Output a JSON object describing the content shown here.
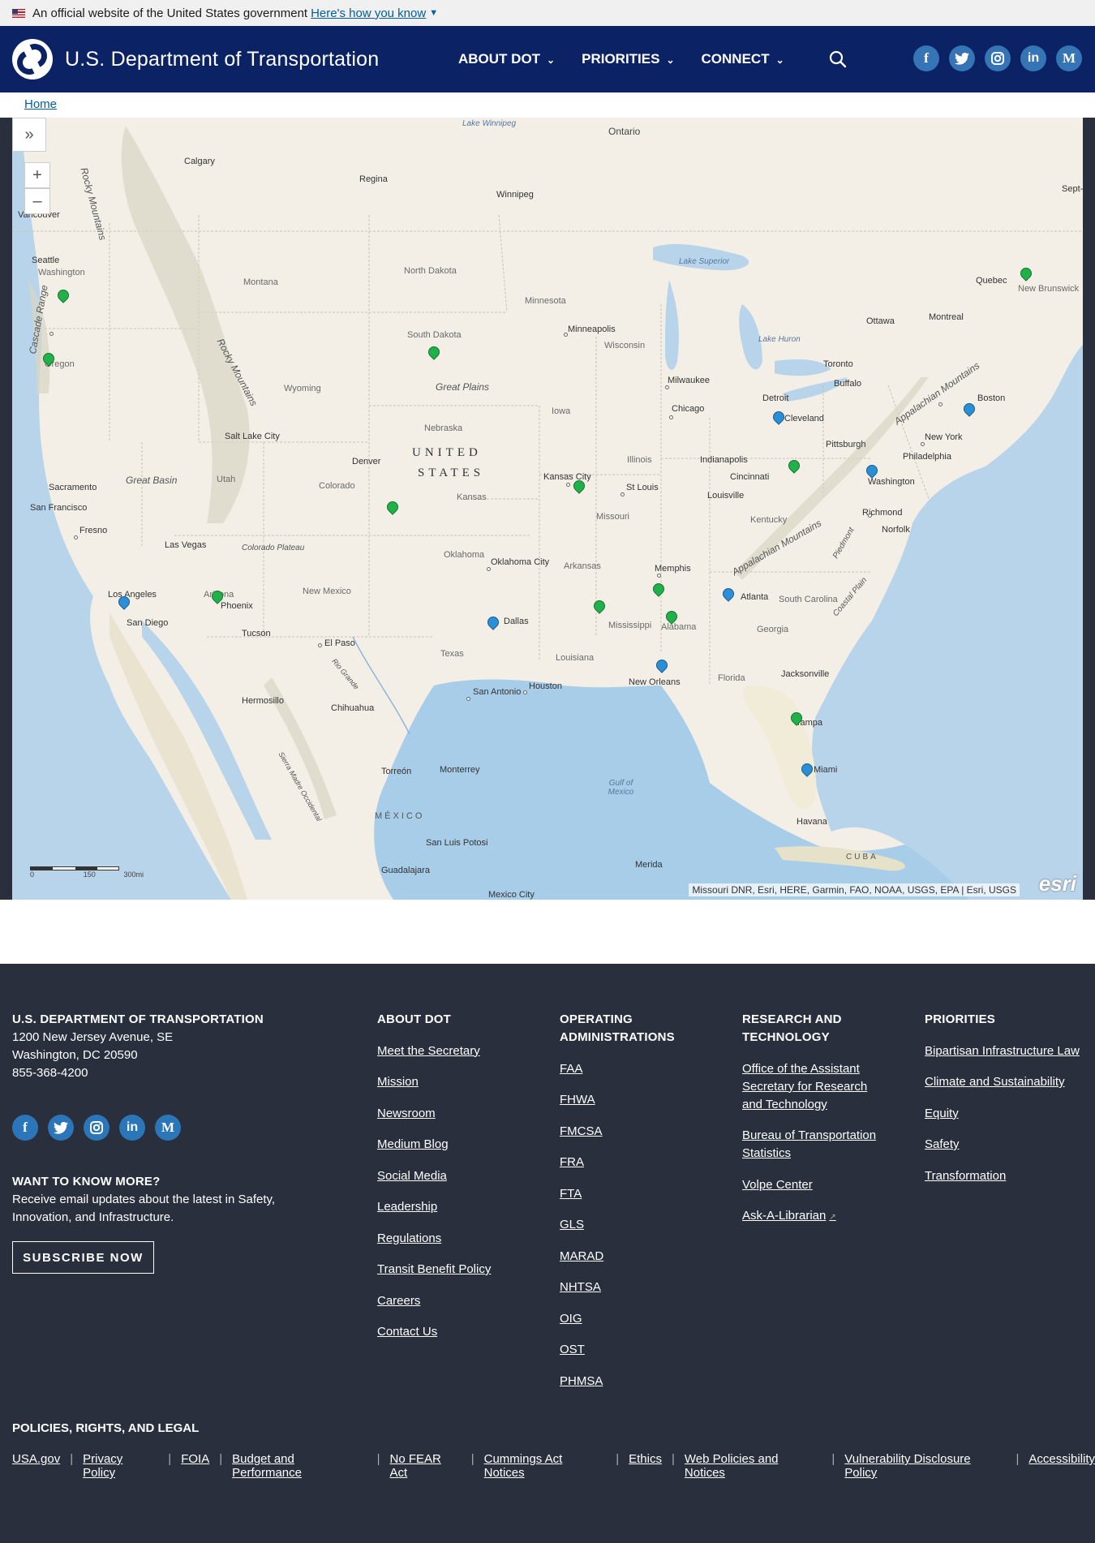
{
  "gov_banner": {
    "text": "An official website of the United States government",
    "link": "Here's how you know"
  },
  "header": {
    "title": "U.S. Department of Transportation",
    "nav": [
      "ABOUT DOT",
      "PRIORITIES",
      "CONNECT"
    ],
    "social": [
      "f",
      "t",
      "ig",
      "in",
      "M"
    ]
  },
  "breadcrumb": {
    "home": "Home"
  },
  "map": {
    "attribution": "Missouri DNR, Esri, HERE, Garmin, FAO, NOAA, USGS, EPA | Esri, USGS",
    "logo": "esri",
    "scale": [
      "0",
      "150",
      "300mi"
    ],
    "labels": {
      "winnipeg_lake": "Lake Winnipeg",
      "ontario": "Ontario",
      "rocky_mountains_n": "Rocky Mountains",
      "calgary": "Calgary",
      "regina": "Regina",
      "winnipeg": "Winnipeg",
      "vancouver": "Vancouver",
      "seattle": "Seattle",
      "washington_state": "Washington",
      "montana": "Montana",
      "north_dakota": "North Dakota",
      "minnesota": "Minnesota",
      "lake_superior": "Lake Superior",
      "quebec": "Quebec",
      "new_brunswick": "New Brunswick",
      "oregon": "Oregon",
      "cascade_range": "Cascade Range",
      "south_dakota": "South Dakota",
      "minneapolis": "Minneapolis",
      "wisconsin": "Wisconsin",
      "ottawa": "Ottawa",
      "montreal": "Montreal",
      "lake_huron": "Lake Huron",
      "rocky_mountains": "Rocky Mountains",
      "great_plains": "Great Plains",
      "milwaukee": "Milwaukee",
      "toronto": "Toronto",
      "buffalo": "Buffalo",
      "wyoming": "Wyoming",
      "iowa": "Iowa",
      "chicago": "Chicago",
      "detroit": "Detroit",
      "cleveland": "Cleveland",
      "boston": "Boston",
      "appalachian_mountains_n": "Appalachian Mountains",
      "nebraska": "Nebraska",
      "salt_lake_city": "Salt Lake City",
      "pittsburgh": "Pittsburgh",
      "new_york": "New York",
      "denver": "Denver",
      "united": "UNITED",
      "states": "STATES",
      "illinois": "Illinois",
      "indianapolis": "Indianapolis",
      "philadelphia": "Philadelphia",
      "utah": "Utah",
      "cincinnati": "Cincinnati",
      "washington_dc": "Washington",
      "sacramento": "Sacramento",
      "great_basin": "Great Basin",
      "colorado": "Colorado",
      "kansas_city": "Kansas City",
      "st_louis": "St Louis",
      "kansas": "Kansas",
      "louisville": "Louisville",
      "san_francisco": "San Francisco",
      "missouri": "Missouri",
      "kentucky": "Kentucky",
      "richmond": "Richmond",
      "fresno": "Fresno",
      "norfolk": "Norfolk",
      "colorado_plateau": "Colorado Plateau",
      "las_vegas": "Las Vegas",
      "appalachian_mountains_s": "Appalachian Mountains",
      "piedmont": "Piedmont",
      "oklahoma": "Oklahoma",
      "oklahoma_city": "Oklahoma City",
      "arkansas": "Arkansas",
      "memphis": "Memphis",
      "los_angeles": "Los Angeles",
      "arizona": "Arizona",
      "phoenix": "Phoenix",
      "new_mexico": "New Mexico",
      "atlanta": "Atlanta",
      "south_carolina": "South Carolina",
      "coastal_plain": "Coastal Plain",
      "san_diego": "San Diego",
      "dallas": "Dallas",
      "mississippi": "Mississippi",
      "alabama": "Alabama",
      "georgia": "Georgia",
      "tucson": "Tucson",
      "el_paso": "El Paso",
      "texas": "Texas",
      "louisiana": "Louisiana",
      "rio_grande": "Rio Grande",
      "new_orleans": "New Orleans",
      "florida": "Florida",
      "jacksonville": "Jacksonville",
      "houston": "Houston",
      "san_antonio": "San Antonio",
      "hermosillo": "Hermosillo",
      "chihuahua": "Chihuahua",
      "tampa": "Tampa",
      "miami": "Miami",
      "sierra_madre": "Sierra Madre Occidental",
      "torreon": "Torreón",
      "monterrey": "Monterrey",
      "gulf_of_mexico": "Gulf of Mexico",
      "mexico": "MÉXICO",
      "havana": "Havana",
      "san_luis_potosi": "San Luis Potosi",
      "merida": "Merida",
      "cuba": "CUBA",
      "guadalajara": "Guadalajara",
      "mexico_city": "Mexico City",
      "sept_iles": "Sept-"
    }
  },
  "footer": {
    "org": {
      "heading": "U.S. DEPARTMENT OF TRANSPORTATION",
      "address1": "1200 New Jersey Avenue, SE",
      "address2": "Washington, DC 20590",
      "phone": "855-368-4200"
    },
    "newsletter": {
      "heading": "WANT TO KNOW MORE?",
      "text": "Receive email updates about the latest in Safety, Innovation, and Infrastructure.",
      "button": "SUBSCRIBE NOW"
    },
    "about": {
      "heading": "ABOUT DOT",
      "links": [
        "Meet the Secretary",
        "Mission",
        "Newsroom",
        "Medium Blog",
        "Social Media",
        "Leadership",
        "Regulations",
        "Transit Benefit Policy",
        "Careers",
        "Contact Us"
      ]
    },
    "operating": {
      "heading": "OPERATING ADMINISTRATIONS",
      "links": [
        "FAA",
        "FHWA",
        "FMCSA",
        "FRA",
        "FTA",
        "GLS",
        "MARAD",
        "NHTSA",
        "OIG",
        "OST",
        "PHMSA"
      ]
    },
    "research": {
      "heading": "RESEARCH AND TECHNOLOGY",
      "links": [
        "Office of the Assistant Secretary for Research and Technology",
        "Bureau of Transportation Statistics",
        "Volpe Center",
        "Ask-A-Librarian"
      ]
    },
    "priorities": {
      "heading": "PRIORITIES",
      "links": [
        "Bipartisan Infrastructure Law",
        "Climate and Sustainability",
        "Equity",
        "Safety",
        "Transformation"
      ]
    },
    "legal": {
      "heading": "POLICIES, RIGHTS, AND LEGAL",
      "links": [
        "USA.gov",
        "Privacy Policy",
        "FOIA",
        "Budget and Performance",
        "No FEAR Act",
        "Cummings Act Notices",
        "Ethics",
        "Web Policies and Notices",
        "Vulnerability Disclosure Policy",
        "Accessibility"
      ]
    }
  }
}
